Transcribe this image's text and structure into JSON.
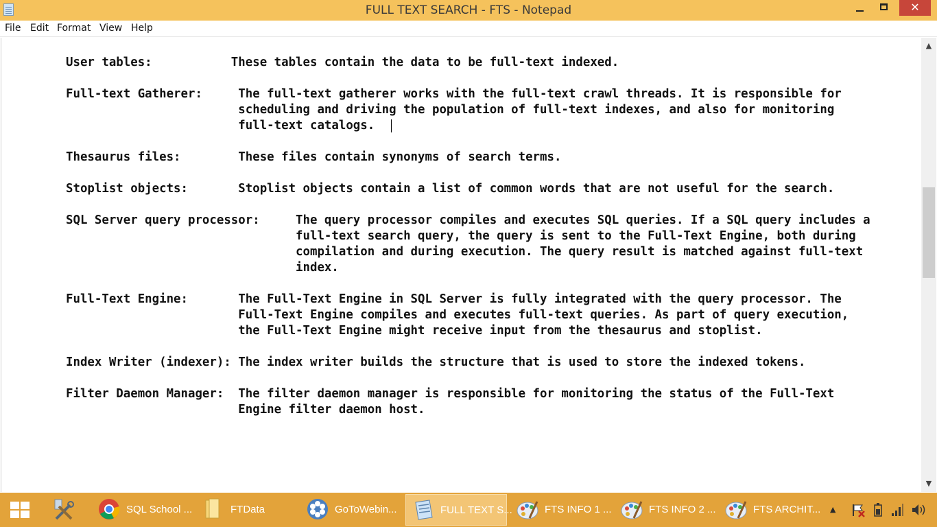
{
  "window": {
    "title": "FULL TEXT SEARCH - FTS - Notepad",
    "minimize": "minimize",
    "maximize": "maximize",
    "close": "✕"
  },
  "menu": [
    "File",
    "Edit",
    "Format",
    "View",
    "Help"
  ],
  "document": {
    "text": "User tables:           These tables contain the data to be full-text indexed.\n\nFull-text Gatherer:     The full-text gatherer works with the full-text crawl threads. It is responsible for\n                        scheduling and driving the population of full-text indexes, and also for monitoring\n                        full-text catalogs.\n\nThesaurus files:        These files contain synonyms of search terms.\n\nStoplist objects:       Stoplist objects contain a list of common words that are not useful for the search.\n\nSQL Server query processor:     The query processor compiles and executes SQL queries. If a SQL query includes a\n                                full-text search query, the query is sent to the Full-Text Engine, both during\n                                compilation and during execution. The query result is matched against full-text\n                                index.\n\nFull-Text Engine:       The Full-Text Engine in SQL Server is fully integrated with the query processor. The\n                        Full-Text Engine compiles and executes full-text queries. As part of query execution,\n                        the Full-Text Engine might receive input from the thesaurus and stoplist.\n\nIndex Writer (indexer): The index writer builds the structure that is used to store the indexed tokens.\n\nFilter Daemon Manager:  The filter daemon manager is responsible for monitoring the status of the Full-Text\n                        Engine filter daemon host."
  },
  "scrollbar": {
    "up": "▲",
    "down": "▼"
  },
  "taskbar": {
    "tasks": [
      {
        "label": "SQL School ...",
        "icon": "chrome-icon",
        "active": false
      },
      {
        "label": "FTData",
        "icon": "folder-icon",
        "active": false
      },
      {
        "label": "GoToWebin...",
        "icon": "gotowebinar-icon",
        "active": false
      },
      {
        "label": "FULL TEXT S...",
        "icon": "notepad-icon",
        "active": true
      },
      {
        "label": "FTS INFO 1 ...",
        "icon": "paint-icon",
        "active": false
      },
      {
        "label": "FTS INFO 2 ...",
        "icon": "paint-icon",
        "active": false
      },
      {
        "label": "FTS ARCHIT...",
        "icon": "paint-icon",
        "active": false
      }
    ],
    "tray": {
      "overflow": "▲"
    }
  },
  "colors": {
    "titlebar": "#f5c25c",
    "taskbar": "#e3a33a",
    "close": "#c7463a"
  }
}
